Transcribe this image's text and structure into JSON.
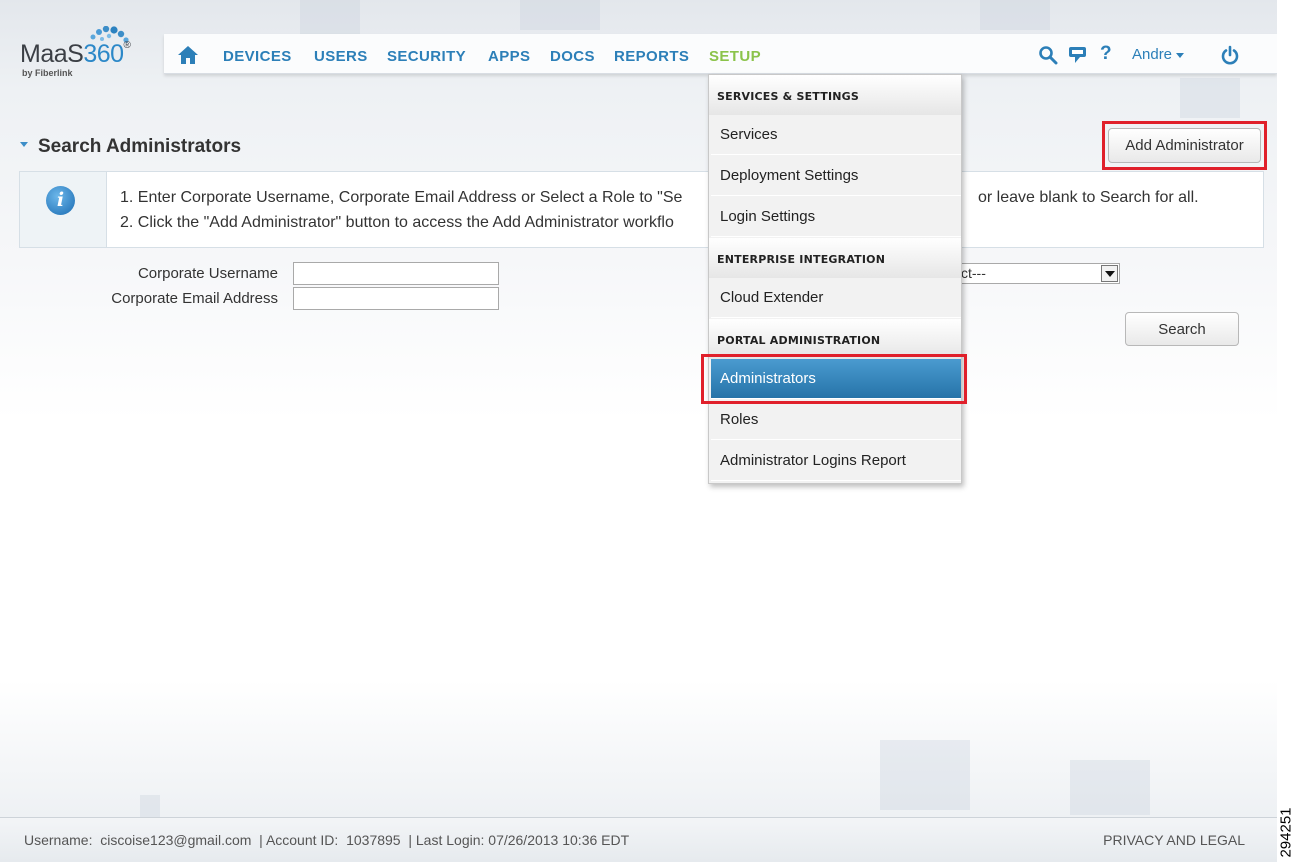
{
  "logo": {
    "brand": "MaaS",
    "brand_num": "360",
    "trademark": "®",
    "sub": "by Fiberlink"
  },
  "nav": {
    "items": [
      "DEVICES",
      "USERS",
      "SECURITY",
      "APPS",
      "DOCS",
      "REPORTS",
      "SETUP"
    ],
    "active": "SETUP",
    "user": "Andre",
    "icons": [
      "home-icon",
      "search-icon",
      "chat-icon",
      "help-icon",
      "power-icon"
    ],
    "help_glyph": "?"
  },
  "page": {
    "title": "Search Administrators",
    "add_button": "Add Administrator"
  },
  "info": {
    "icon_glyph": "i",
    "line1": "1. Enter Corporate Username, Corporate Email Address or Select a Role to \"Se",
    "line1_tail": "or leave blank to Search for all.",
    "line2": "2. Click the \"Add Administrator\" button to access the Add Administrator workflo"
  },
  "form": {
    "username_label": "Corporate Username",
    "email_label": "Corporate Email Address",
    "username_value": "",
    "email_value": "",
    "role_select_value": "ct---",
    "search_button": "Search"
  },
  "menu": {
    "sections": [
      {
        "header": "SERVICES & SETTINGS",
        "items": [
          "Services",
          "Deployment Settings",
          "Login Settings"
        ]
      },
      {
        "header": "ENTERPRISE INTEGRATION",
        "items": [
          "Cloud Extender"
        ]
      },
      {
        "header": "PORTAL ADMINISTRATION",
        "items": [
          "Administrators",
          "Roles",
          "Administrator Logins Report"
        ]
      }
    ],
    "selected": "Administrators"
  },
  "footer": {
    "status": "Username:  ciscoise123@gmail.com  | Account ID:  1037895  | Last Login: 07/26/2013 10:36 EDT",
    "link": "PRIVACY AND LEGAL"
  },
  "figure_code": "294251",
  "colors": {
    "accent": "#2c7fb8",
    "setup": "#8bc34a",
    "highlight": "#e0202b",
    "menu_active": "#2673a8"
  }
}
